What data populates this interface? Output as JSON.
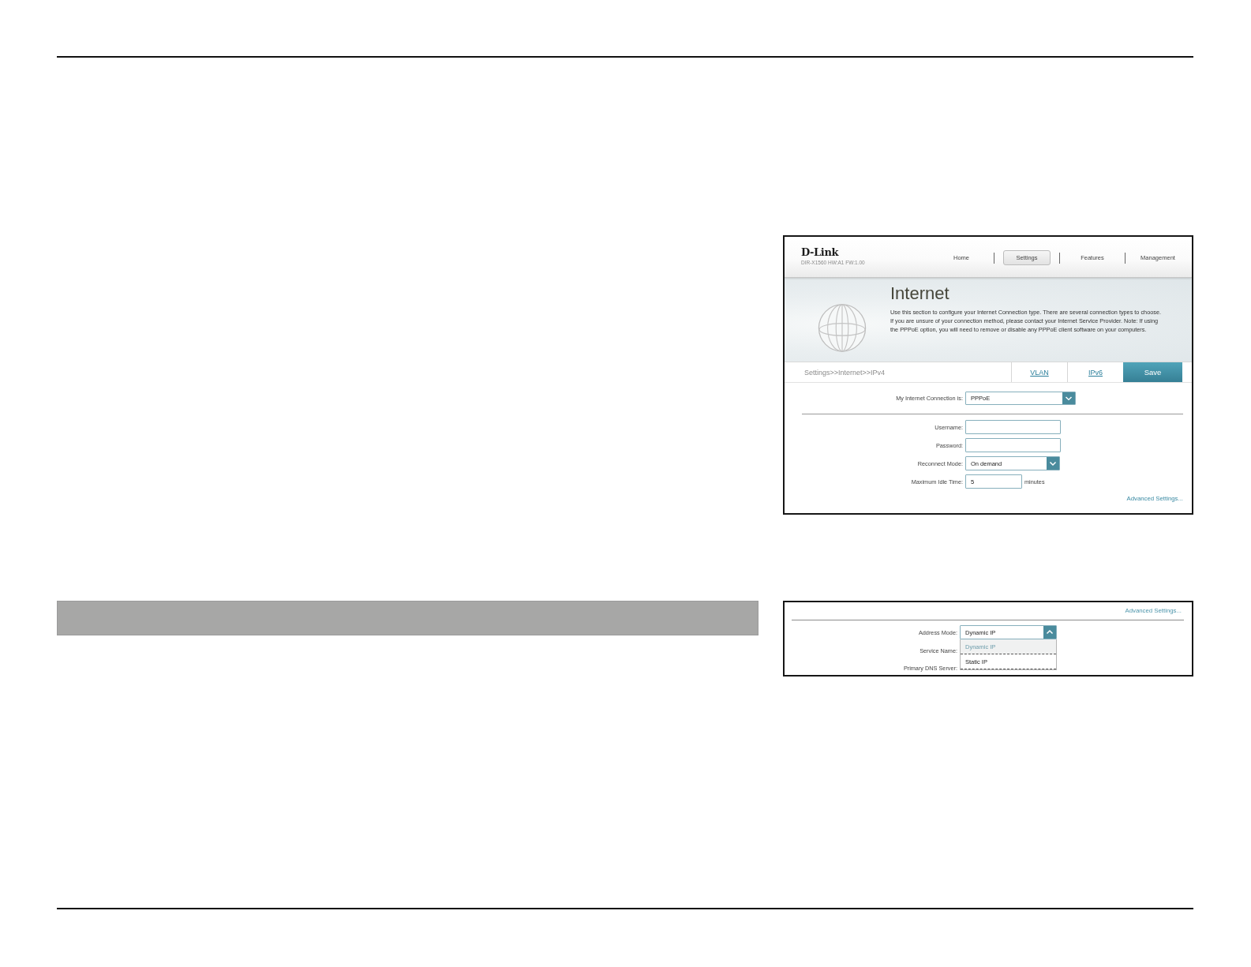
{
  "router_page": {
    "logo": "D-Link",
    "model_info": "DIR-X1560 HW:A1 FW:1.00",
    "nav": [
      {
        "label": "Home",
        "selected": false
      },
      {
        "label": "Settings",
        "selected": true
      },
      {
        "label": "Features",
        "selected": false
      },
      {
        "label": "Management",
        "selected": false
      }
    ],
    "banner": {
      "title": "Internet",
      "description_lines": [
        "Use this section to configure your Internet Connection type. There are several connection types to choose.",
        "If you are unsure of your connection method, please contact your Internet Service Provider. Note: If using",
        "the PPPoE option, you will need to remove or disable any PPPoE client software on your computers."
      ]
    },
    "breadcrumb": "Settings>>Internet>>IPv4",
    "actions": [
      {
        "label": "VLAN",
        "kind": "link"
      },
      {
        "label": "IPv6",
        "kind": "link"
      },
      {
        "label": "Save",
        "kind": "primary"
      }
    ],
    "connection": {
      "label": "My Internet Connection is:",
      "value": "PPPoE"
    },
    "fields": [
      {
        "kind": "text",
        "label": "Username:"
      },
      {
        "kind": "password",
        "label": "Password:"
      },
      {
        "kind": "select",
        "label": "Reconnect Mode:",
        "value": "On demand"
      },
      {
        "kind": "number",
        "label": "Maximum Idle Time:",
        "value": "5",
        "unit": "minutes"
      }
    ],
    "advanced_link": "Advanced Settings..."
  },
  "address_mode_snippet": {
    "advanced_link": "Advanced Settings...",
    "address_mode": {
      "label": "Address Mode:",
      "value": "Dynamic IP",
      "expanded": true,
      "options": [
        {
          "label": "Dynamic IP",
          "selected": true
        },
        {
          "label": "Static IP",
          "selected": false
        }
      ]
    },
    "labels_behind": [
      "Service Name:",
      "Primary DNS Server:"
    ]
  }
}
